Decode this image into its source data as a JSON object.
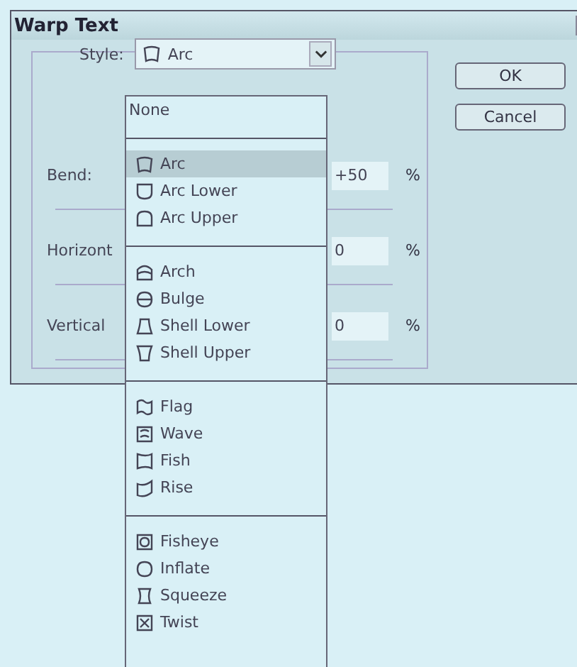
{
  "window": {
    "title": "Warp Text"
  },
  "style": {
    "label": "Style:",
    "value": "Arc",
    "kind": "arc"
  },
  "rows": [
    {
      "label": "Bend:",
      "value": "+50",
      "unit": "%"
    },
    {
      "label": "Horizont",
      "value": "0",
      "unit": "%"
    },
    {
      "label": "Vertical",
      "value": "0",
      "unit": "%"
    }
  ],
  "buttons": [
    "OK",
    "Cancel"
  ],
  "dropdown": {
    "none_option": {
      "label": "None",
      "selected": false
    },
    "groups": [
      [
        {
          "label": "Arc",
          "kind": "arc",
          "selected": true
        },
        {
          "label": "Arc Lower",
          "kind": "arc-lower",
          "selected": false
        },
        {
          "label": "Arc Upper",
          "kind": "arc-upper",
          "selected": false
        }
      ],
      [
        {
          "label": "Arch",
          "kind": "arch",
          "selected": false
        },
        {
          "label": "Bulge",
          "kind": "bulge",
          "selected": false
        },
        {
          "label": "Shell Lower",
          "kind": "shell-lower",
          "selected": false
        },
        {
          "label": "Shell Upper",
          "kind": "shell-upper",
          "selected": false
        }
      ],
      [
        {
          "label": "Flag",
          "kind": "flag",
          "selected": false
        },
        {
          "label": "Wave",
          "kind": "wave",
          "selected": false
        },
        {
          "label": "Fish",
          "kind": "fish",
          "selected": false
        },
        {
          "label": "Rise",
          "kind": "rise",
          "selected": false
        }
      ],
      [
        {
          "label": "Fisheye",
          "kind": "fisheye",
          "selected": false
        },
        {
          "label": "Inflate",
          "kind": "inflate",
          "selected": false
        },
        {
          "label": "Squeeze",
          "kind": "squeeze",
          "selected": false
        },
        {
          "label": "Twist",
          "kind": "twist",
          "selected": false
        }
      ]
    ]
  }
}
